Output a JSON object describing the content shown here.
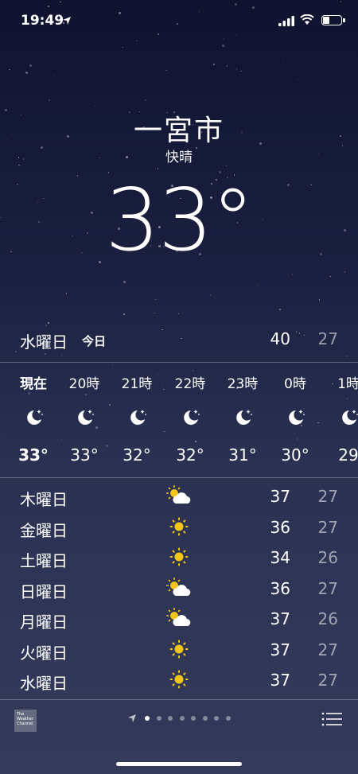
{
  "status": {
    "time": "19:49"
  },
  "location": {
    "city": "一宮市",
    "condition": "快晴",
    "temperature": "33°"
  },
  "today": {
    "day": "水曜日",
    "tag": "今日",
    "high": "40",
    "low": "27"
  },
  "hourly": [
    {
      "label": "現在",
      "temp": "33°",
      "icon": "moon-stars-icon"
    },
    {
      "label": "20時",
      "temp": "33°",
      "icon": "moon-stars-icon"
    },
    {
      "label": "21時",
      "temp": "32°",
      "icon": "moon-stars-icon"
    },
    {
      "label": "22時",
      "temp": "32°",
      "icon": "moon-stars-icon"
    },
    {
      "label": "23時",
      "temp": "31°",
      "icon": "moon-stars-icon"
    },
    {
      "label": "0時",
      "temp": "30°",
      "icon": "moon-stars-icon"
    },
    {
      "label": "1時",
      "temp": "29",
      "icon": "moon-stars-icon"
    }
  ],
  "daily": [
    {
      "day": "木曜日",
      "icon": "partly-cloudy-icon",
      "high": "37",
      "low": "27"
    },
    {
      "day": "金曜日",
      "icon": "sun-icon",
      "high": "36",
      "low": "27"
    },
    {
      "day": "土曜日",
      "icon": "sun-icon",
      "high": "34",
      "low": "26"
    },
    {
      "day": "日曜日",
      "icon": "partly-cloudy-icon",
      "high": "36",
      "low": "27"
    },
    {
      "day": "月曜日",
      "icon": "partly-cloudy-icon",
      "high": "37",
      "low": "26"
    },
    {
      "day": "火曜日",
      "icon": "sun-icon",
      "high": "37",
      "low": "27"
    },
    {
      "day": "水曜日",
      "icon": "sun-icon",
      "high": "37",
      "low": "27"
    }
  ],
  "footer": {
    "provider": "The Weather Channel",
    "pages": 8,
    "active_page": 1
  },
  "colors": {
    "sun": "#f5c518",
    "low_text": "#9aa0b8"
  }
}
